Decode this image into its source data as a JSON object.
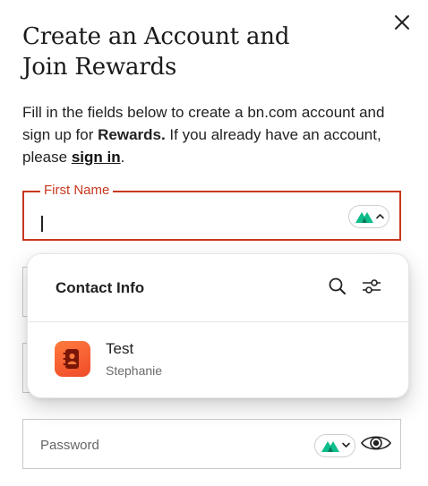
{
  "header": {
    "title_line1": "Create an Account and",
    "title_line2": "Join Rewards"
  },
  "intro": {
    "text_before": "Fill in the fields below to create a bn.com account and sign up for ",
    "rewards": "Rewards.",
    "text_middle": " If you already have an account, please ",
    "signin_link": "sign in",
    "text_after": "."
  },
  "form": {
    "first_name_label": "First Name",
    "first_name_value": "",
    "password_label": "Password"
  },
  "autofill": {
    "title": "Contact Info",
    "items": [
      {
        "name": "Test",
        "subtitle": "Stephanie"
      }
    ]
  },
  "colors": {
    "error_red": "#c8381f",
    "nordpass_green": "#0dbd8b",
    "contact_orange": "#ef4b2a"
  },
  "icons": [
    "close-icon",
    "nordpass-icon",
    "chevron-up-icon",
    "chevron-down-icon",
    "search-icon",
    "sliders-icon",
    "contact-book-icon",
    "eye-icon"
  ]
}
